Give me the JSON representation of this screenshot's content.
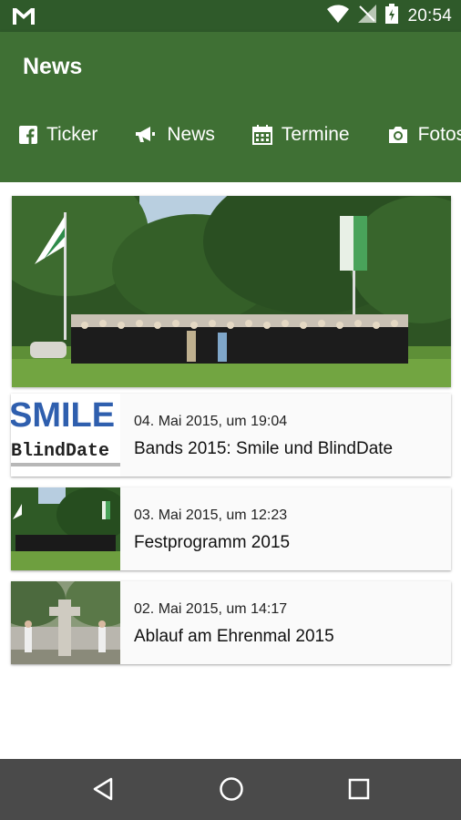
{
  "status_bar": {
    "time": "20:54"
  },
  "app_bar": {
    "title": "News"
  },
  "tabs": [
    {
      "label": "Ticker",
      "icon": "facebook-icon"
    },
    {
      "label": "News",
      "icon": "megaphone-icon"
    },
    {
      "label": "Termine",
      "icon": "calendar-icon"
    },
    {
      "label": "Fotos",
      "icon": "camera-icon"
    }
  ],
  "colors": {
    "primary": "#3f7034",
    "status_bar": "#2f5a2a",
    "nav_bar": "#4a4a4a"
  },
  "hero": {
    "alt_icon": "group-photo"
  },
  "news": [
    {
      "date": "04. Mai 2015, um 19:04",
      "title": "Bands 2015: Smile und BlindDate",
      "thumb_text_1": "SMILE",
      "thumb_text_2": "BlindDate"
    },
    {
      "date": "03. Mai 2015, um 12:23",
      "title": "Festprogramm 2015"
    },
    {
      "date": "02. Mai 2015, um 14:17",
      "title": "Ablauf am Ehrenmal 2015"
    }
  ]
}
